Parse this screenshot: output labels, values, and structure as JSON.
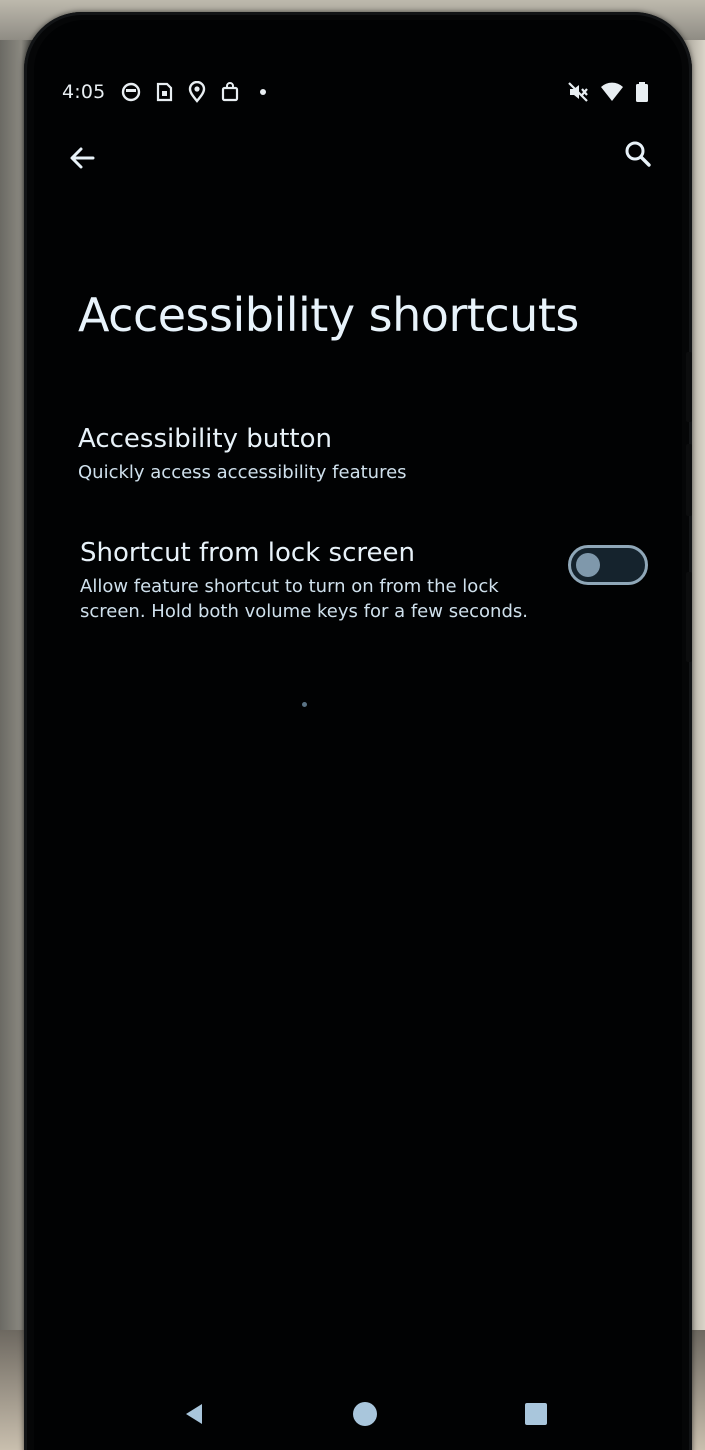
{
  "status_bar": {
    "time": "4:05",
    "left_icons": [
      "circle-face-icon",
      "sim-card-icon",
      "map-pin-icon",
      "shopping-bag-icon",
      "dot-icon"
    ],
    "right_icons": [
      "mute-icon",
      "wifi-icon",
      "battery-icon"
    ]
  },
  "app_bar": {
    "back_icon": "arrow-left-icon",
    "search_icon": "search-icon"
  },
  "page": {
    "title": "Accessibility shortcuts"
  },
  "settings": [
    {
      "title": "Accessibility button",
      "summary": "Quickly access accessibility features"
    },
    {
      "title": "Shortcut from lock screen",
      "summary": "Allow feature shortcut to turn on from the lock screen. Hold both volume keys for a few seconds.",
      "toggle_on": false
    }
  ],
  "nav_bar": {
    "back_icon": "triangle-back-icon",
    "home_icon": "circle-home-icon",
    "recents_icon": "square-recents-icon"
  },
  "colors": {
    "screen_bg": "#010203",
    "text_primary": "#e8f2f9",
    "toggle_border": "#8fa7b8",
    "toggle_thumb": "#7f98ab",
    "nav_icon": "#a9c6dc"
  }
}
